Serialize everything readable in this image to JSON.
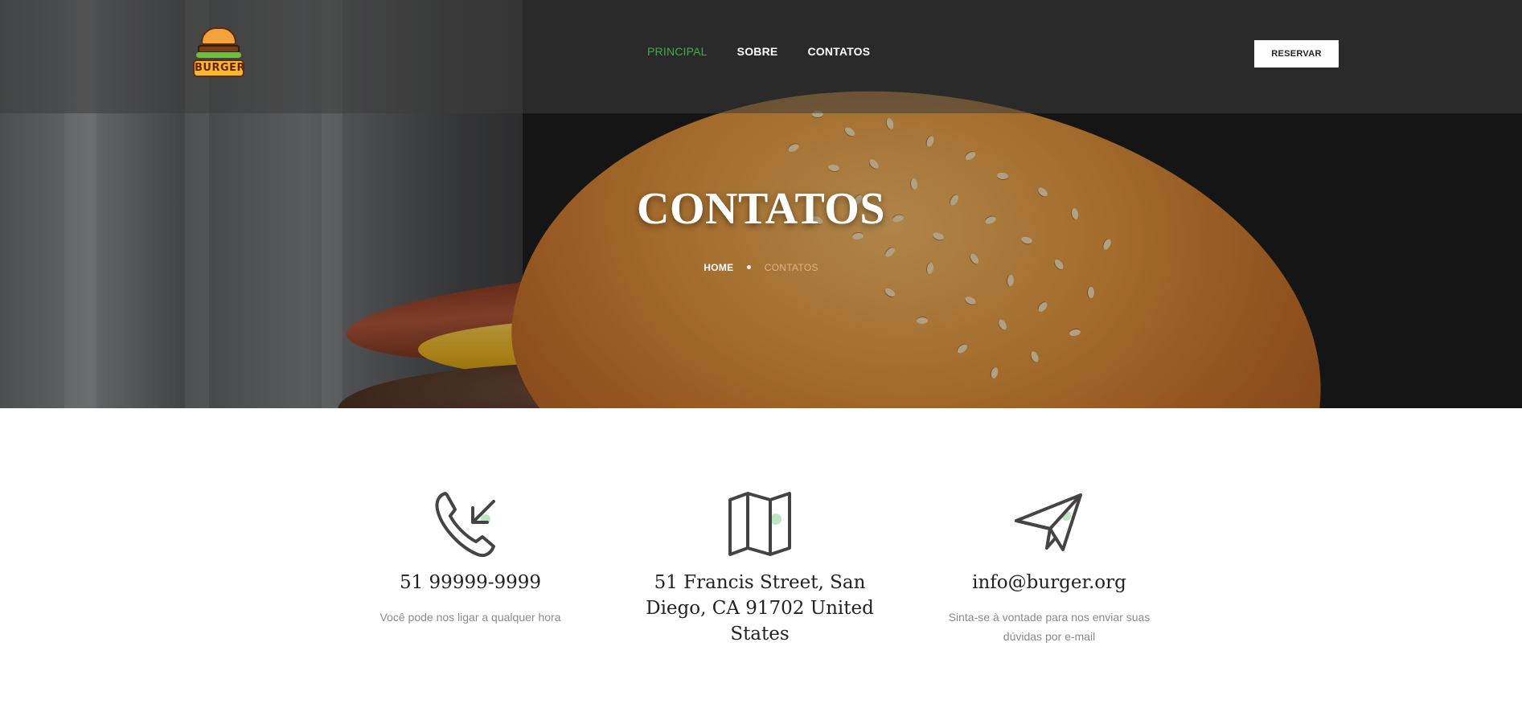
{
  "header": {
    "logo_text": "BURGER",
    "nav": [
      {
        "label": "PRINCIPAL",
        "active": true
      },
      {
        "label": "SOBRE",
        "active": false
      },
      {
        "label": "CONTATOS",
        "active": false
      }
    ],
    "reserve_label": "RESERVAR",
    "accent_color": "#3fae4a"
  },
  "hero": {
    "title": "CONTATOS",
    "breadcrumb": {
      "home": "HOME",
      "current": "CONTATOS"
    }
  },
  "contacts": [
    {
      "icon": "phone-incoming-icon",
      "heading": "51 99999-9999",
      "desc": "Você pode nos ligar a qualquer hora"
    },
    {
      "icon": "map-icon",
      "heading": "51 Francis Street, San Diego, CA 91702 United States",
      "desc": ""
    },
    {
      "icon": "paper-plane-icon",
      "heading": "info@burger.org",
      "desc": "Sinta-se à vontade para nos enviar suas dúvidas por e-mail"
    }
  ]
}
